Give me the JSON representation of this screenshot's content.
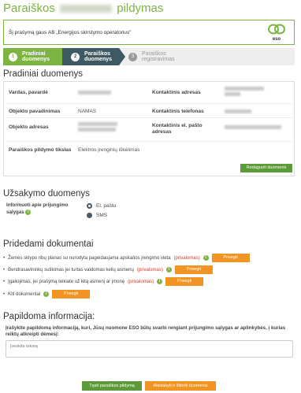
{
  "page": {
    "title_prefix": "Paraiškos",
    "title_suffix": "pildymas"
  },
  "notice": {
    "text": "Šį prašymą gaus AB „Energijos skirstymo operatorius\"",
    "logo_text": "eso"
  },
  "steps": [
    {
      "num": "1",
      "label1": "Pradiniai",
      "label2": "duomenys"
    },
    {
      "num": "2",
      "label1": "Paraiškos",
      "label2": "duomenys"
    },
    {
      "num": "3",
      "label1": "Paraiškos",
      "label2": "registravimas"
    }
  ],
  "initial": {
    "heading": "Pradiniai duomenys",
    "name_label": "Vardas, pavardė",
    "address_label": "Kontaktinis adresas",
    "object_name_label": "Objekto pavadinimas",
    "object_name_value": "NAMAS",
    "phone_label": "Kontaktinis telefonas",
    "object_address_label": "Objekto adresas",
    "email_label": "Kontaktinis el. pašto adresas",
    "purpose_label": "Paraiškos pildymo tikslas",
    "purpose_value": "Elektros įrenginių iškėlimas",
    "edit_button": "Redaguoti duomenis"
  },
  "order": {
    "heading": "Užsakymo duomenys",
    "inform_label": "Informuoti apie prijungimo sąlygas",
    "options": [
      "El. paštu",
      "SMS"
    ]
  },
  "documents": {
    "heading": "Pridedami dokumentai",
    "items": [
      {
        "text": "Žemės sklypo ribų planas su nurodyta pageidaujama apskaitos įrengimo vieta",
        "required": "(privalomas)"
      },
      {
        "text": "Bendrasavininkų sutikimas jei turtas valdomas kelių asmenų",
        "required": "(privalomas)"
      },
      {
        "text": "Įgaliojimas, jei prašymą teikiate už kitą asmenį ar įmonę",
        "required": "(privalomas)"
      },
      {
        "text": "Kiti dokumentai",
        "required": ""
      }
    ],
    "attach_label": "Prisegti"
  },
  "additional": {
    "heading": "Papildoma informacija:",
    "prompt": "Įrašykite papildomą informaciją, kuri, Jūsų nuomone ESO būtų svarbi rengiant prijungimo sąlygas ar aplinkybes, į kurias reiktų atkreipti dėmesį:",
    "placeholder": "Įveskite tekstą"
  },
  "footer": {
    "continue_button": "Tęsti paraiškos pildymą",
    "cancel_button": "Atsisakyti ir ištrinti duomenis"
  },
  "colors": {
    "brand_green": "#7cb342",
    "button_green": "#5d9b3a",
    "button_orange": "#f29423",
    "step_active": "#3d5962",
    "required_red": "#d0402a"
  }
}
